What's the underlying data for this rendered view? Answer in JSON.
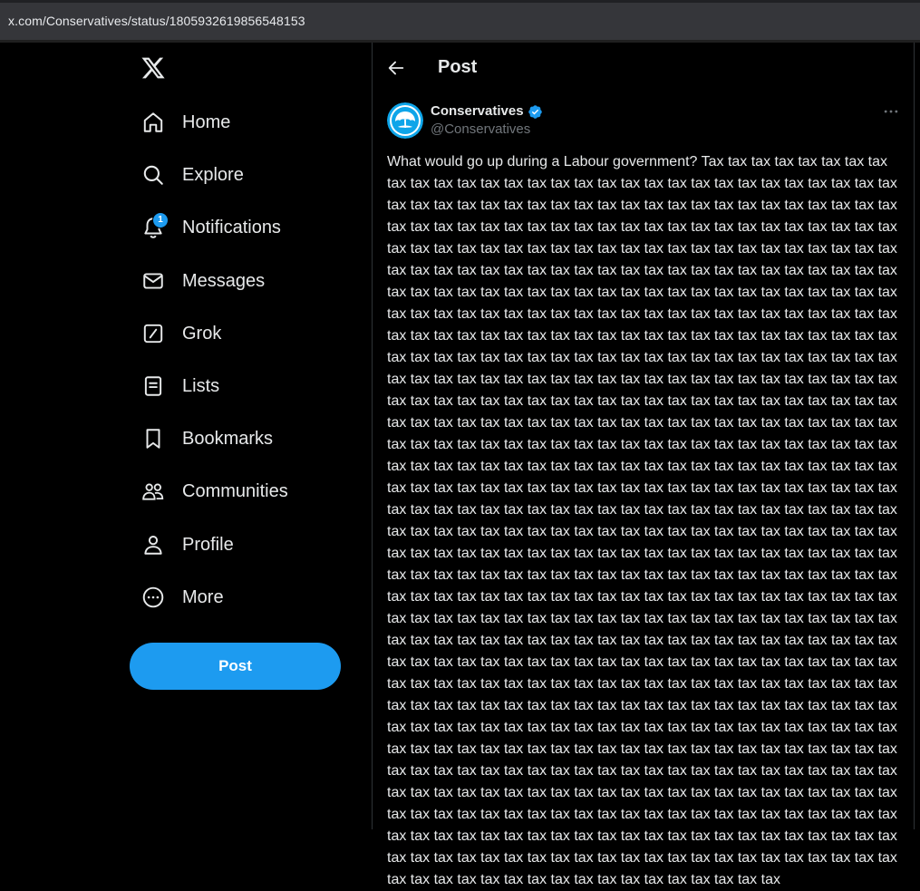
{
  "browser": {
    "url": "x.com/Conservatives/status/1805932619856548153"
  },
  "sidebar": {
    "logo_icon": "x-logo-icon",
    "items": [
      {
        "label": "Home",
        "icon": "home-icon"
      },
      {
        "label": "Explore",
        "icon": "search-icon"
      },
      {
        "label": "Notifications",
        "icon": "bell-icon",
        "badge": "1"
      },
      {
        "label": "Messages",
        "icon": "envelope-icon"
      },
      {
        "label": "Grok",
        "icon": "grok-icon"
      },
      {
        "label": "Lists",
        "icon": "list-icon"
      },
      {
        "label": "Bookmarks",
        "icon": "bookmark-icon"
      },
      {
        "label": "Communities",
        "icon": "communities-icon"
      },
      {
        "label": "Profile",
        "icon": "person-icon"
      },
      {
        "label": "More",
        "icon": "more-circle-icon"
      }
    ],
    "post_button": "Post"
  },
  "header": {
    "title": "Post",
    "back_icon": "arrow-left-icon"
  },
  "post": {
    "author_name": "Conservatives",
    "author_handle": "@Conservatives",
    "verified": true,
    "text": "What would go up during a Labour government? Tax tax tax tax tax tax tax tax tax tax tax tax tax tax tax tax tax tax tax tax tax tax tax tax tax tax tax tax tax tax tax tax tax tax tax tax tax tax tax tax tax tax tax tax tax tax tax tax tax tax tax tax tax tax tax tax tax tax tax tax tax tax tax tax tax tax tax tax tax tax tax tax tax tax tax tax tax tax tax tax tax tax tax tax tax tax tax tax tax tax tax tax tax tax tax tax tax tax tax tax tax tax tax tax tax tax tax tax tax tax tax tax tax tax tax tax tax tax tax tax tax tax tax tax tax tax tax tax tax tax tax tax tax tax tax tax tax tax tax tax tax tax tax tax tax tax tax tax tax tax tax tax tax tax tax tax tax tax tax tax tax tax tax tax tax tax tax tax tax tax tax tax tax tax tax tax tax tax tax tax tax tax tax tax tax tax tax tax tax tax tax tax tax tax tax tax tax tax tax tax tax tax tax tax tax tax tax tax tax tax tax tax tax tax tax tax tax tax tax tax tax tax tax tax tax tax tax tax tax tax tax tax tax tax tax tax tax tax tax tax tax tax tax tax tax tax tax tax tax tax tax tax tax tax tax tax tax tax tax tax tax tax tax tax tax tax tax tax tax tax tax tax tax tax tax tax tax tax tax tax tax tax tax tax tax tax tax tax tax tax tax tax tax tax tax tax tax tax tax tax tax tax tax tax tax tax tax tax tax tax tax tax tax tax tax tax tax tax tax tax tax tax tax tax tax tax tax tax tax tax tax tax tax tax tax tax tax tax tax tax tax tax tax tax tax tax tax tax tax tax tax tax tax tax tax tax tax tax tax tax tax tax tax tax tax tax tax tax tax tax tax tax tax tax tax tax tax tax tax tax tax tax tax tax tax tax tax tax tax tax tax tax tax tax tax tax tax tax tax tax tax tax tax tax tax tax tax tax tax tax tax tax tax tax tax tax tax tax tax tax tax tax tax tax tax tax tax tax tax tax tax tax tax tax tax tax tax tax tax tax tax tax tax tax tax tax tax tax tax tax tax tax tax tax tax tax tax tax tax tax tax tax tax tax tax tax tax tax tax tax tax tax tax tax tax tax tax tax tax tax tax tax tax tax tax tax tax tax tax tax tax tax tax tax tax tax tax tax tax tax tax tax tax tax tax tax tax tax tax tax tax tax tax tax tax tax tax tax tax tax tax tax tax tax tax tax tax tax tax tax tax tax tax tax tax tax tax tax tax tax tax tax tax tax tax tax tax tax tax tax tax tax tax tax tax tax tax tax tax tax tax tax tax tax tax tax tax tax tax tax tax tax tax tax tax tax tax tax tax tax tax tax tax tax tax tax tax tax tax tax tax tax tax tax tax tax tax tax tax tax tax tax tax tax tax tax tax tax tax tax tax tax tax tax tax tax tax tax tax tax tax tax tax tax tax tax tax tax tax tax tax tax tax tax tax tax tax tax tax tax tax tax tax tax tax tax tax tax tax tax tax tax tax tax tax tax tax tax tax tax tax tax tax tax tax tax tax tax tax tax tax tax tax tax tax tax tax tax tax tax tax tax tax tax tax tax tax tax tax tax tax tax tax tax tax tax tax tax tax tax tax tax tax tax tax tax tax tax tax tax tax tax tax tax tax tax tax tax tax tax tax tax tax tax tax tax tax tax tax"
  },
  "colors": {
    "accent": "#1d9bf0",
    "background": "#000000",
    "text": "#e7e9ea",
    "muted": "#71767b"
  }
}
